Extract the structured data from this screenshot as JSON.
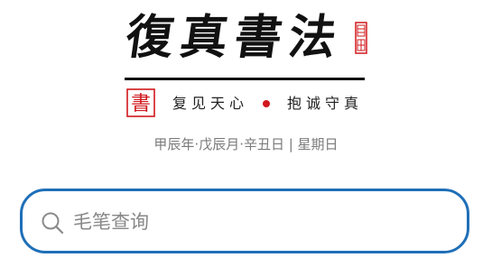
{
  "logo": {
    "text": "復真書法",
    "icon": "seal-stamp-icon"
  },
  "motto": {
    "seal_char": "書",
    "left": "复见天心",
    "right": "抱诚守真",
    "dot_color": "#d0181d"
  },
  "date_line": "甲辰年·戊辰月·辛丑日 | 星期日",
  "search": {
    "placeholder": "毛笔查询",
    "value": "",
    "icon": "search-icon",
    "border_color": "#1f6fb8"
  },
  "colors": {
    "accent_blue": "#1f6fb8",
    "seal_red": "#d0181d",
    "ink": "#111111",
    "muted_text": "#7a7a7a"
  }
}
